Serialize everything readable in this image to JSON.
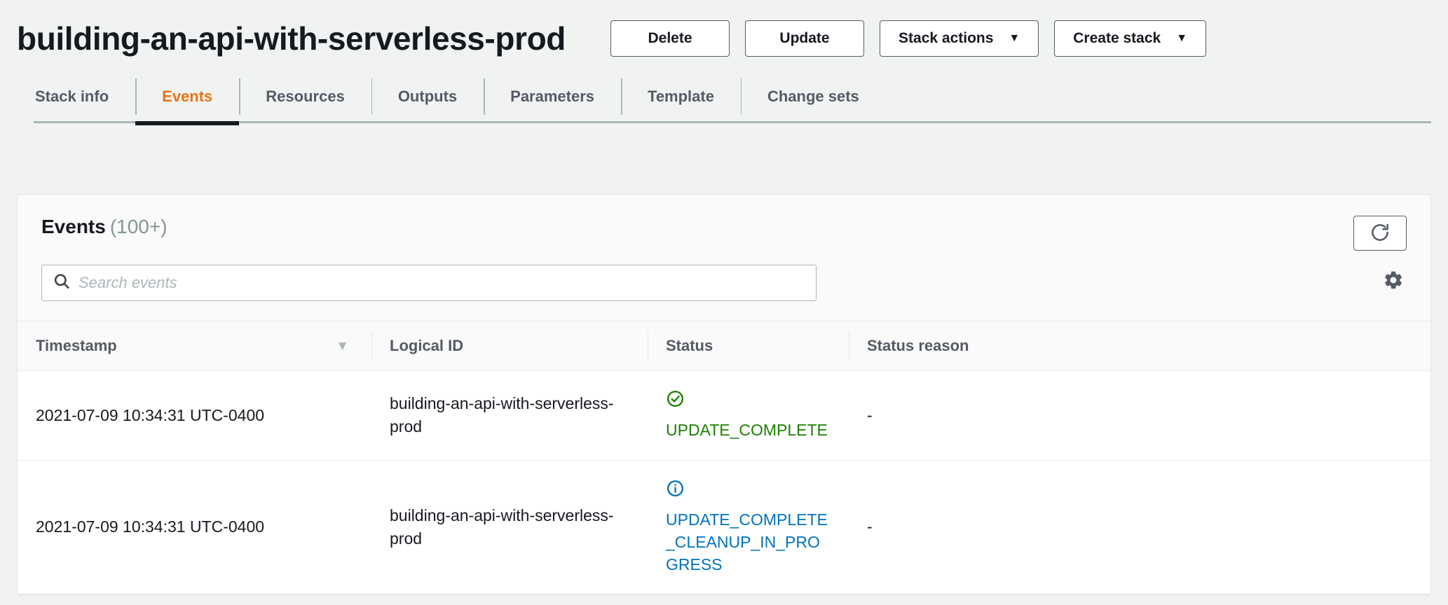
{
  "header": {
    "title": "building-an-api-with-serverless-prod",
    "actions": [
      {
        "label": "Delete",
        "caret": ""
      },
      {
        "label": "Update",
        "caret": ""
      },
      {
        "label": "Stack actions",
        "caret": "▼"
      },
      {
        "label": "Create stack",
        "caret": "▼"
      }
    ]
  },
  "tabs": [
    {
      "label": "Stack info",
      "active": false
    },
    {
      "label": "Events",
      "active": true
    },
    {
      "label": "Resources",
      "active": false
    },
    {
      "label": "Outputs",
      "active": false
    },
    {
      "label": "Parameters",
      "active": false
    },
    {
      "label": "Template",
      "active": false
    },
    {
      "label": "Change sets",
      "active": false
    }
  ],
  "panel": {
    "title": "Events",
    "count": "(100+)",
    "refresh_icon": "refresh-icon",
    "settings_icon": "gear-icon"
  },
  "search": {
    "placeholder": "Search events",
    "value": "",
    "icon": "search-icon"
  },
  "table": {
    "columns": [
      {
        "label": "Timestamp",
        "sort": "▼"
      },
      {
        "label": "Logical ID",
        "sort": ""
      },
      {
        "label": "Status",
        "sort": ""
      },
      {
        "label": "Status reason",
        "sort": ""
      }
    ],
    "rows": [
      {
        "timestamp": "2021-07-09 10:34:31 UTC-0400",
        "logical_id": "building-an-api-with-serverless-prod",
        "status": "UPDATE_COMPLETE",
        "status_kind": "success",
        "status_icon": "check-circle-icon",
        "status_reason": "-"
      },
      {
        "timestamp": "2021-07-09 10:34:31 UTC-0400",
        "logical_id": "building-an-api-with-serverless-prod",
        "status": "UPDATE_COMPLETE_CLEANUP_IN_PROGRESS",
        "status_kind": "info",
        "status_icon": "info-circle-icon",
        "status_reason": "-"
      }
    ]
  },
  "colors": {
    "accent_orange": "#ec7211",
    "status_success": "#1d8102",
    "status_info": "#0073bb",
    "text_primary": "#16191f",
    "text_secondary": "#545b64",
    "page_bg": "#f1f3f3"
  }
}
